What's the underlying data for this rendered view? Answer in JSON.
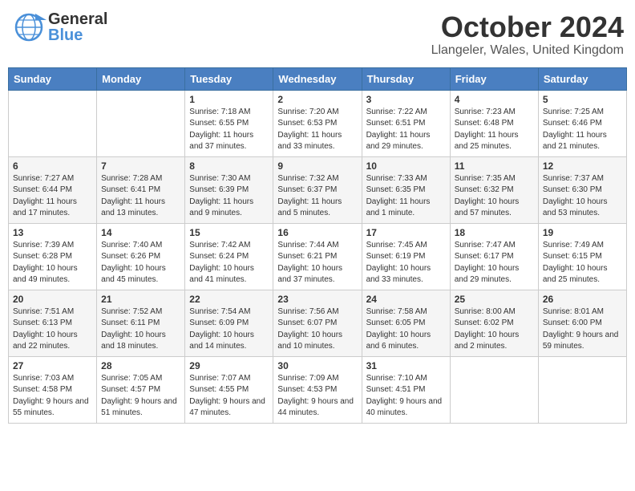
{
  "header": {
    "logo_general": "General",
    "logo_blue": "Blue",
    "title": "October 2024",
    "location": "Llangeler, Wales, United Kingdom"
  },
  "days_of_week": [
    "Sunday",
    "Monday",
    "Tuesday",
    "Wednesday",
    "Thursday",
    "Friday",
    "Saturday"
  ],
  "weeks": [
    [
      {
        "day": "",
        "info": ""
      },
      {
        "day": "",
        "info": ""
      },
      {
        "day": "1",
        "info": "Sunrise: 7:18 AM\nSunset: 6:55 PM\nDaylight: 11 hours and 37 minutes."
      },
      {
        "day": "2",
        "info": "Sunrise: 7:20 AM\nSunset: 6:53 PM\nDaylight: 11 hours and 33 minutes."
      },
      {
        "day": "3",
        "info": "Sunrise: 7:22 AM\nSunset: 6:51 PM\nDaylight: 11 hours and 29 minutes."
      },
      {
        "day": "4",
        "info": "Sunrise: 7:23 AM\nSunset: 6:48 PM\nDaylight: 11 hours and 25 minutes."
      },
      {
        "day": "5",
        "info": "Sunrise: 7:25 AM\nSunset: 6:46 PM\nDaylight: 11 hours and 21 minutes."
      }
    ],
    [
      {
        "day": "6",
        "info": "Sunrise: 7:27 AM\nSunset: 6:44 PM\nDaylight: 11 hours and 17 minutes."
      },
      {
        "day": "7",
        "info": "Sunrise: 7:28 AM\nSunset: 6:41 PM\nDaylight: 11 hours and 13 minutes."
      },
      {
        "day": "8",
        "info": "Sunrise: 7:30 AM\nSunset: 6:39 PM\nDaylight: 11 hours and 9 minutes."
      },
      {
        "day": "9",
        "info": "Sunrise: 7:32 AM\nSunset: 6:37 PM\nDaylight: 11 hours and 5 minutes."
      },
      {
        "day": "10",
        "info": "Sunrise: 7:33 AM\nSunset: 6:35 PM\nDaylight: 11 hours and 1 minute."
      },
      {
        "day": "11",
        "info": "Sunrise: 7:35 AM\nSunset: 6:32 PM\nDaylight: 10 hours and 57 minutes."
      },
      {
        "day": "12",
        "info": "Sunrise: 7:37 AM\nSunset: 6:30 PM\nDaylight: 10 hours and 53 minutes."
      }
    ],
    [
      {
        "day": "13",
        "info": "Sunrise: 7:39 AM\nSunset: 6:28 PM\nDaylight: 10 hours and 49 minutes."
      },
      {
        "day": "14",
        "info": "Sunrise: 7:40 AM\nSunset: 6:26 PM\nDaylight: 10 hours and 45 minutes."
      },
      {
        "day": "15",
        "info": "Sunrise: 7:42 AM\nSunset: 6:24 PM\nDaylight: 10 hours and 41 minutes."
      },
      {
        "day": "16",
        "info": "Sunrise: 7:44 AM\nSunset: 6:21 PM\nDaylight: 10 hours and 37 minutes."
      },
      {
        "day": "17",
        "info": "Sunrise: 7:45 AM\nSunset: 6:19 PM\nDaylight: 10 hours and 33 minutes."
      },
      {
        "day": "18",
        "info": "Sunrise: 7:47 AM\nSunset: 6:17 PM\nDaylight: 10 hours and 29 minutes."
      },
      {
        "day": "19",
        "info": "Sunrise: 7:49 AM\nSunset: 6:15 PM\nDaylight: 10 hours and 25 minutes."
      }
    ],
    [
      {
        "day": "20",
        "info": "Sunrise: 7:51 AM\nSunset: 6:13 PM\nDaylight: 10 hours and 22 minutes."
      },
      {
        "day": "21",
        "info": "Sunrise: 7:52 AM\nSunset: 6:11 PM\nDaylight: 10 hours and 18 minutes."
      },
      {
        "day": "22",
        "info": "Sunrise: 7:54 AM\nSunset: 6:09 PM\nDaylight: 10 hours and 14 minutes."
      },
      {
        "day": "23",
        "info": "Sunrise: 7:56 AM\nSunset: 6:07 PM\nDaylight: 10 hours and 10 minutes."
      },
      {
        "day": "24",
        "info": "Sunrise: 7:58 AM\nSunset: 6:05 PM\nDaylight: 10 hours and 6 minutes."
      },
      {
        "day": "25",
        "info": "Sunrise: 8:00 AM\nSunset: 6:02 PM\nDaylight: 10 hours and 2 minutes."
      },
      {
        "day": "26",
        "info": "Sunrise: 8:01 AM\nSunset: 6:00 PM\nDaylight: 9 hours and 59 minutes."
      }
    ],
    [
      {
        "day": "27",
        "info": "Sunrise: 7:03 AM\nSunset: 4:58 PM\nDaylight: 9 hours and 55 minutes."
      },
      {
        "day": "28",
        "info": "Sunrise: 7:05 AM\nSunset: 4:57 PM\nDaylight: 9 hours and 51 minutes."
      },
      {
        "day": "29",
        "info": "Sunrise: 7:07 AM\nSunset: 4:55 PM\nDaylight: 9 hours and 47 minutes."
      },
      {
        "day": "30",
        "info": "Sunrise: 7:09 AM\nSunset: 4:53 PM\nDaylight: 9 hours and 44 minutes."
      },
      {
        "day": "31",
        "info": "Sunrise: 7:10 AM\nSunset: 4:51 PM\nDaylight: 9 hours and 40 minutes."
      },
      {
        "day": "",
        "info": ""
      },
      {
        "day": "",
        "info": ""
      }
    ]
  ]
}
